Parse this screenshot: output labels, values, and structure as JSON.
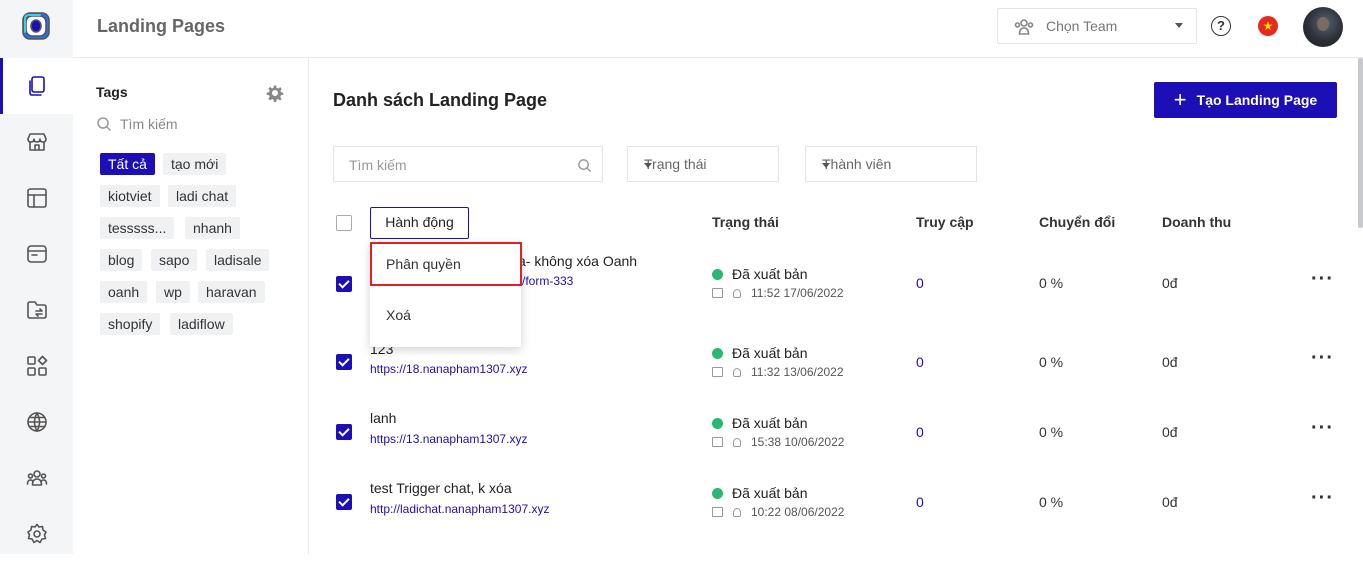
{
  "app": {
    "title": "Landing Pages"
  },
  "header": {
    "team_placeholder": "Chọn Team",
    "help": "?",
    "flag": "★"
  },
  "rail": {
    "items": [
      "pages-icon",
      "store-icon",
      "layout-icon",
      "browser-icon",
      "folder-swap-icon",
      "apps-icon",
      "globe-icon",
      "team-icon",
      "settings-icon"
    ]
  },
  "tags": {
    "header": "Tags",
    "search_placeholder": "Tìm kiếm",
    "items": [
      "Tất cả",
      "tạo mới",
      "kiotviet",
      "ladi chat",
      "tesssss...",
      "nhanh",
      "blog",
      "sapo",
      "ladisale",
      "oanh",
      "wp",
      "haravan",
      "shopify",
      "ladiflow"
    ]
  },
  "main": {
    "heading": "Danh sách Landing Page",
    "create_button": "Tạo Landing Page",
    "search_placeholder": "Tìm kiếm",
    "status_filter": "Trạng thái",
    "member_filter": "Thành viên",
    "action_button": "Hành động",
    "columns": {
      "status": "Trạng thái",
      "visits": "Truy cập",
      "conversion": "Chuyển đổi",
      "revenue": "Doanh thu"
    }
  },
  "dropdown": {
    "items": [
      "Phân quyền",
      "Xoá"
    ]
  },
  "rows": [
    {
      "name": "a- không xóa Oanh",
      "url": "/form-333",
      "status": "Đã xuất bản",
      "time": "11:52 17/06/2022",
      "visits": "0",
      "conversion": "0 %",
      "revenue": "0đ",
      "more": "···"
    },
    {
      "name": "123",
      "url": "https://18.nanapham1307.xyz",
      "status": "Đã xuất bản",
      "time": "11:32 13/06/2022",
      "visits": "0",
      "conversion": "0 %",
      "revenue": "0đ",
      "more": "···"
    },
    {
      "name": "lanh",
      "url": "https://13.nanapham1307.xyz",
      "status": "Đã xuất bản",
      "time": "15:38 10/06/2022",
      "visits": "0",
      "conversion": "0 %",
      "revenue": "0đ",
      "more": "···"
    },
    {
      "name": "test Trigger chat, k xóa",
      "url": "http://ladichat.nanapham1307.xyz",
      "status": "Đã xuất bản",
      "time": "10:22 08/06/2022",
      "visits": "0",
      "conversion": "0 %",
      "revenue": "0đ",
      "more": "···"
    }
  ]
}
